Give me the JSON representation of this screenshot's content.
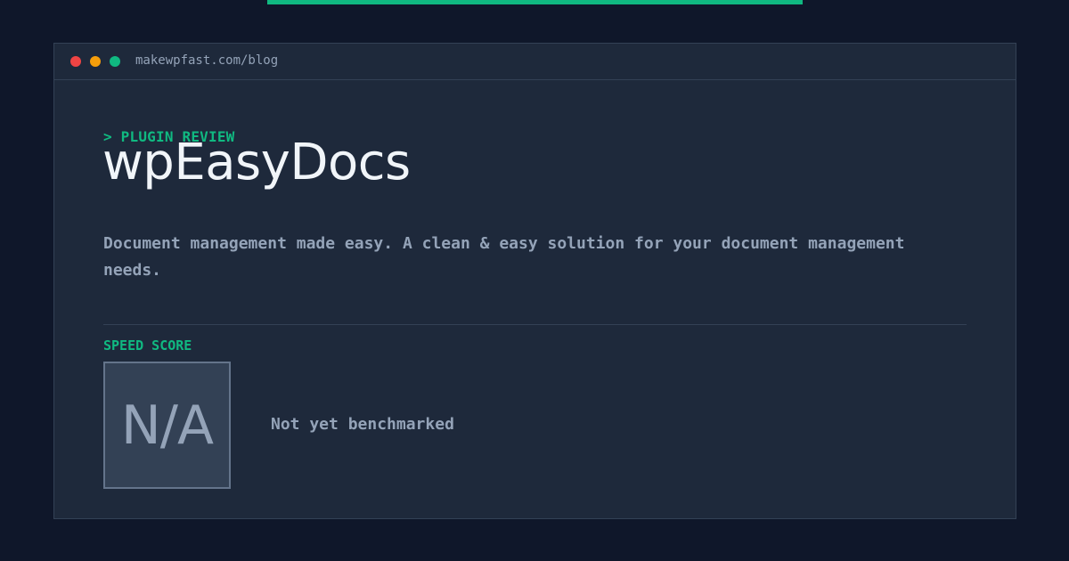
{
  "window": {
    "url": "makewpfast.com/blog"
  },
  "article": {
    "eyebrow": "> PLUGIN REVIEW",
    "title": "wpEasyDocs",
    "description": "Document management made easy. A clean & easy solution for your document management needs."
  },
  "speed": {
    "label": "SPEED SCORE",
    "value": "N/A",
    "status": "Not yet benchmarked"
  },
  "colors": {
    "background": "#0f172a",
    "panel": "#1e293b",
    "accent": "#10b981",
    "text_primary": "#f1f5f9",
    "text_muted": "#94a3b8",
    "dot_red": "#ef4444",
    "dot_yellow": "#f59e0b",
    "dot_green": "#10b981"
  }
}
